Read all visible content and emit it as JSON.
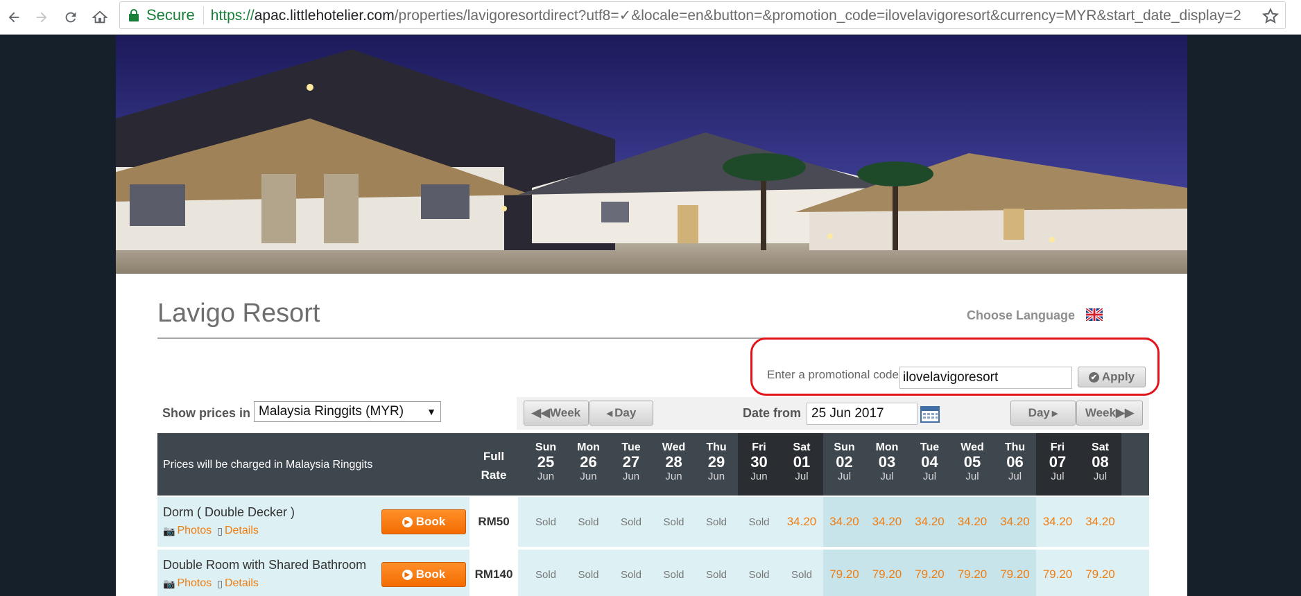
{
  "browser": {
    "secure_label": "Secure",
    "url_scheme": "https://",
    "url_host": "apac.littlehotelier.com",
    "url_path": "/properties/lavigoresortdirect?utf8=✓&locale=en&button=&promotion_code=ilovelavigoresort&currency=MYR&start_date_display=2"
  },
  "header": {
    "hotel_name": "Lavigo Resort",
    "choose_language": "Choose Language"
  },
  "promo": {
    "label": "Enter a promotional code",
    "value": "ilovelavigoresort",
    "apply_label": "Apply"
  },
  "controls": {
    "show_prices_label": "Show prices in",
    "currency_selected": "Malaysia Ringgits (MYR)",
    "week_prev": "Week",
    "day_prev": "Day",
    "date_from_label": "Date from",
    "date_from_value": "25 Jun 2017",
    "day_next": "Day",
    "week_next": "Week"
  },
  "grid": {
    "header_text": "Prices will be charged in Malaysia Ringgits",
    "full_rate_line1": "Full",
    "full_rate_line2": "Rate",
    "days": [
      {
        "dow": "Sun",
        "day": "25",
        "mon": "Jun",
        "weekend": false
      },
      {
        "dow": "Mon",
        "day": "26",
        "mon": "Jun",
        "weekend": false
      },
      {
        "dow": "Tue",
        "day": "27",
        "mon": "Jun",
        "weekend": false
      },
      {
        "dow": "Wed",
        "day": "28",
        "mon": "Jun",
        "weekend": false
      },
      {
        "dow": "Thu",
        "day": "29",
        "mon": "Jun",
        "weekend": false
      },
      {
        "dow": "Fri",
        "day": "30",
        "mon": "Jun",
        "weekend": true
      },
      {
        "dow": "Sat",
        "day": "01",
        "mon": "Jul",
        "weekend": true
      },
      {
        "dow": "Sun",
        "day": "02",
        "mon": "Jul",
        "weekend": false
      },
      {
        "dow": "Mon",
        "day": "03",
        "mon": "Jul",
        "weekend": false
      },
      {
        "dow": "Tue",
        "day": "04",
        "mon": "Jul",
        "weekend": false
      },
      {
        "dow": "Wed",
        "day": "05",
        "mon": "Jul",
        "weekend": false
      },
      {
        "dow": "Thu",
        "day": "06",
        "mon": "Jul",
        "weekend": false
      },
      {
        "dow": "Fri",
        "day": "07",
        "mon": "Jul",
        "weekend": true
      },
      {
        "dow": "Sat",
        "day": "08",
        "mon": "Jul",
        "weekend": true
      }
    ],
    "rooms": [
      {
        "name": "Dorm ( Double Decker )",
        "photos_label": "Photos",
        "details_label": "Details",
        "book_label": "Book",
        "full_rate": "RM50",
        "cells": [
          "Sold",
          "Sold",
          "Sold",
          "Sold",
          "Sold",
          "Sold",
          "34.20",
          "34.20",
          "34.20",
          "34.20",
          "34.20",
          "34.20",
          "34.20",
          "34.20"
        ]
      },
      {
        "name": "Double Room with Shared Bathroom",
        "photos_label": "Photos",
        "details_label": "Details",
        "book_label": "Book",
        "full_rate": "RM140",
        "cells": [
          "Sold",
          "Sold",
          "Sold",
          "Sold",
          "Sold",
          "Sold",
          "Sold",
          "79.20",
          "79.20",
          "79.20",
          "79.20",
          "79.20",
          "79.20",
          "79.20"
        ]
      }
    ]
  },
  "colors": {
    "accent_orange": "#f07d10",
    "header_dark": "#3e464e",
    "weekend_dark": "#2a2e32",
    "row_bg": "#ddf0f4",
    "promo_highlight": "#e3131b",
    "secure_green": "#188038"
  }
}
